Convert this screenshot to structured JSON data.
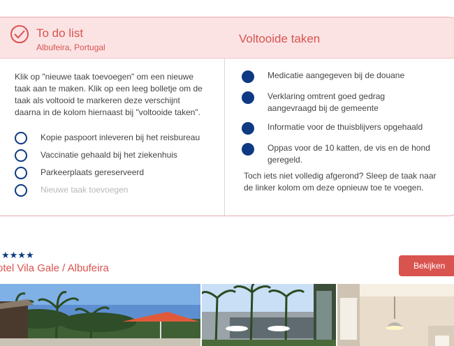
{
  "todo": {
    "title": "To do list",
    "location": "Albufeira, Portugal",
    "instructions": "Klik op \"nieuwe taak toevoegen\" om een nieuwe taak aan te maken. Klik op een leeg bolletje om de taak als voltooid te markeren deze verschijnt daarna in de kolom hiernaast bij \"voltooide taken\".",
    "items": [
      {
        "label": "Kopie paspoort inleveren bij het reisbureau"
      },
      {
        "label": "Vaccinatie gehaald bij het ziekenhuis"
      },
      {
        "label": "Parkeerplaats gereserveerd"
      }
    ],
    "new_task_label": "Nieuwe taak toevoegen"
  },
  "done": {
    "title": "Voltooide taken",
    "items": [
      {
        "label": "Medicatie aangegeven bij de douane"
      },
      {
        "label": "Verklaring omtrent goed gedrag aangevraagd bij de gemeente"
      },
      {
        "label": "Informatie voor de thuisblijvers opgehaald"
      },
      {
        "label": "Oppas voor de 10 katten, de vis en de hond geregeld."
      }
    ],
    "drag_note": "Toch iets niet volledig afgerond? Sleep de taak naar de linker kolom om deze opnieuw toe te voegen."
  },
  "hotel": {
    "stars": "★★★★",
    "rating": 4,
    "name": "otel Vila Gale / Albufeira",
    "view_button": "Bekijken"
  },
  "colors": {
    "accent": "#d9534f",
    "navy": "#0d3a83",
    "header_bg": "#fbe3e4"
  },
  "icons": {
    "header": "check-circle-icon",
    "todo": "empty-circle-icon",
    "done": "filled-circle-icon"
  }
}
